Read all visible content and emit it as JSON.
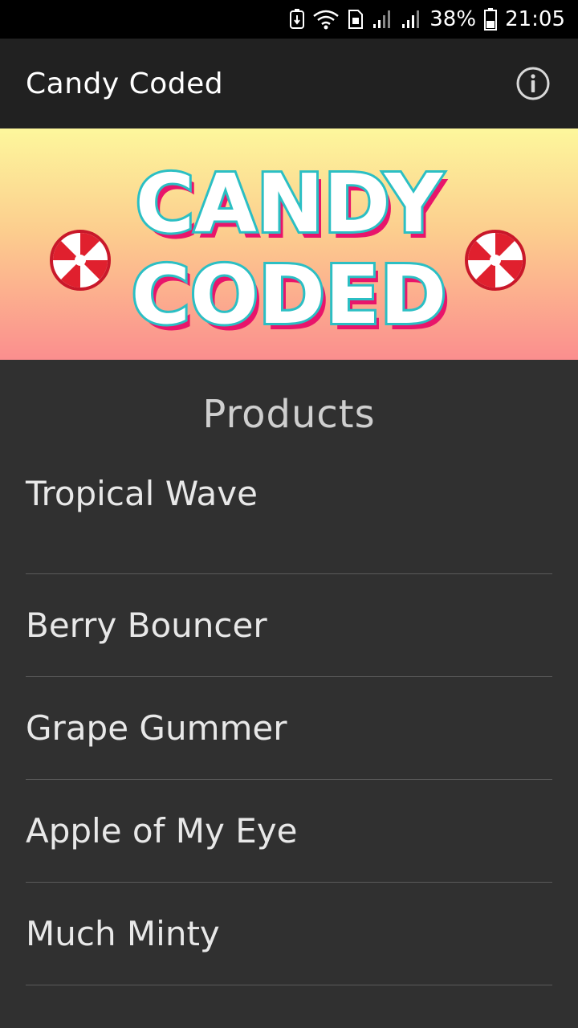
{
  "status_bar": {
    "battery_percent": "38%",
    "time": "21:05",
    "icons": [
      "usb-notification-icon",
      "wifi-icon",
      "sim-icon",
      "signal-icon",
      "signal-icon",
      "battery-icon"
    ]
  },
  "app_bar": {
    "title": "Candy Coded",
    "info_icon": "info-icon"
  },
  "banner": {
    "line1": "CANDY",
    "line2": "CODED",
    "colors": {
      "fill": "#ffffff",
      "outline": "#2bbfc4",
      "shadow": "#e8156b",
      "candy_red": "#e0202e"
    }
  },
  "main": {
    "section_title": "Products",
    "products": [
      {
        "name": "Tropical Wave"
      },
      {
        "name": "Berry Bouncer"
      },
      {
        "name": "Grape Gummer"
      },
      {
        "name": "Apple of My Eye"
      },
      {
        "name": "Much Minty"
      }
    ]
  }
}
